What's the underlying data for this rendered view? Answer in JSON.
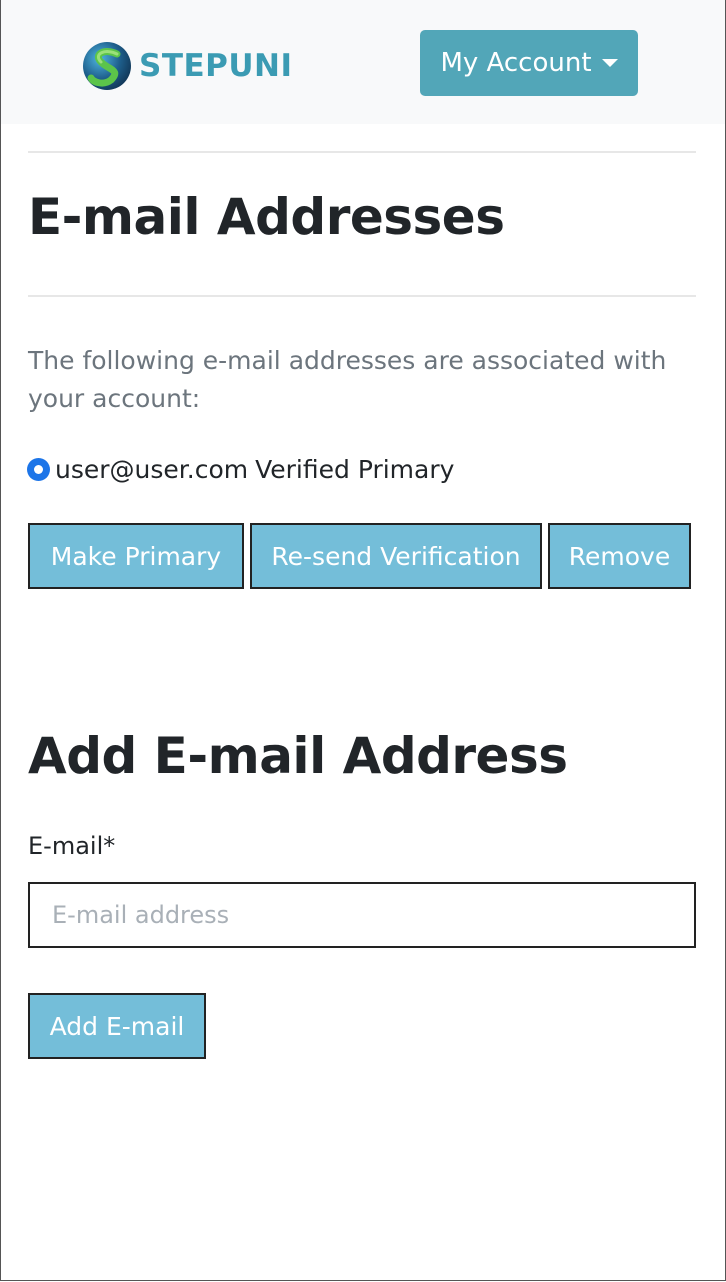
{
  "navbar": {
    "brand": "STEPUNI",
    "account_button": "My Account"
  },
  "emails": {
    "title": "E-mail Addresses",
    "intro": "The following e-mail addresses are associated with your account:",
    "list": [
      {
        "address": "user@user.com",
        "status": "Verified Primary",
        "selected": true
      }
    ],
    "actions": {
      "make_primary": "Make Primary",
      "resend": "Re-send Verification",
      "remove": "Remove"
    }
  },
  "add_email": {
    "title": "Add E-mail Address",
    "label": "E-mail*",
    "placeholder": "E-mail address",
    "value": "",
    "submit": "Add E-mail"
  },
  "colors": {
    "navbar_bg": "#f8f9fa",
    "brand": "#3b9bb3",
    "account_button": "#52a6b8",
    "action_button": "#74bed9",
    "radio": "#1d75e8"
  }
}
